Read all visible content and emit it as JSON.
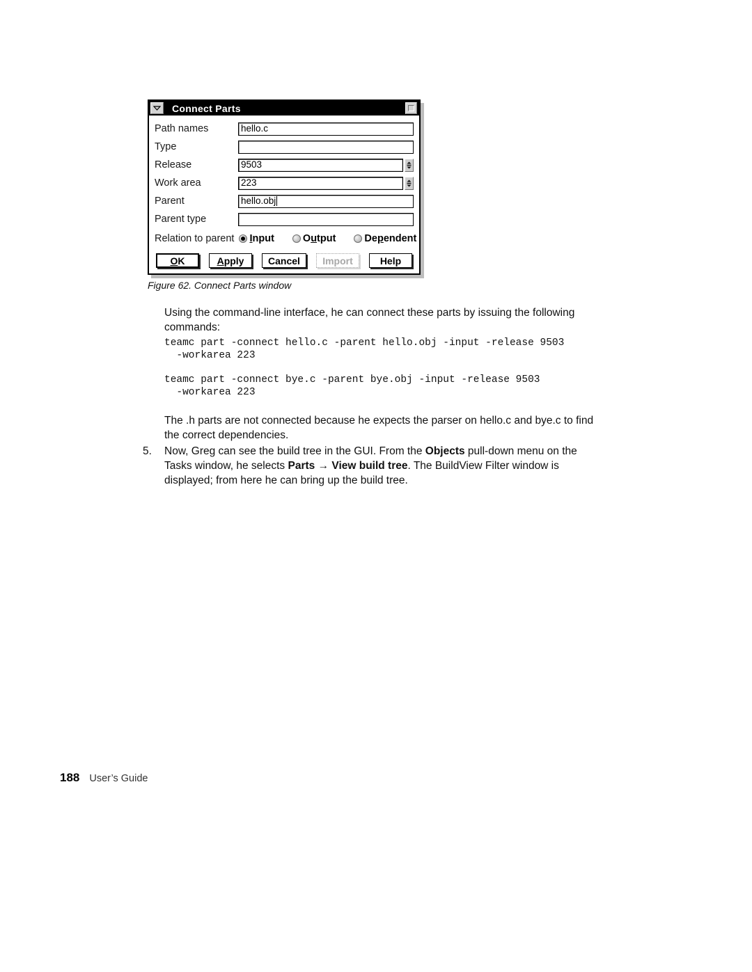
{
  "dialog": {
    "title": "Connect Parts",
    "window_menu_icon": "chevron-down-icon",
    "maximize_icon": "maximize-icon",
    "fields": [
      {
        "label": "Path names",
        "value": "hello.c",
        "spinner": false,
        "caret": false
      },
      {
        "label": "Type",
        "value": "",
        "spinner": false,
        "caret": false
      },
      {
        "label": "Release",
        "value": "9503",
        "spinner": true,
        "caret": false
      },
      {
        "label": "Work area",
        "value": "223",
        "spinner": true,
        "caret": false
      },
      {
        "label": "Parent",
        "value": "hello.obj",
        "spinner": false,
        "caret": true
      },
      {
        "label": "Parent type",
        "value": "",
        "spinner": false,
        "caret": false
      }
    ],
    "relation": {
      "label": "Relation to parent",
      "options": [
        {
          "pre": "",
          "mnemonic": "I",
          "post": "nput",
          "selected": true
        },
        {
          "pre": "O",
          "mnemonic": "u",
          "post": "tput",
          "selected": false
        },
        {
          "pre": "De",
          "mnemonic": "p",
          "post": "endent",
          "selected": false
        }
      ]
    },
    "buttons": [
      {
        "pre": "",
        "mnemonic": "O",
        "post": "K",
        "state": "default"
      },
      {
        "pre": "",
        "mnemonic": "A",
        "post": "pply",
        "state": "normal"
      },
      {
        "pre": "Cancel",
        "mnemonic": "",
        "post": "",
        "state": "normal"
      },
      {
        "pre": "Import",
        "mnemonic": "",
        "post": "",
        "state": "disabled"
      },
      {
        "pre": "Help",
        "mnemonic": "",
        "post": "",
        "state": "normal"
      }
    ]
  },
  "document": {
    "figure_caption": "Figure 62. Connect Parts window",
    "intro_paragraph": "Using the command-line interface, he can connect these parts by issuing the following commands:",
    "code_block_1": "teamc part -connect hello.c -parent hello.obj -input -release 9503\n  -workarea 223",
    "code_block_2": "teamc part -connect bye.c -parent bye.obj -input -release 9503\n  -workarea 223",
    "h_paragraph": "The .h parts are not connected because he expects the parser on hello.c and bye.c to find the correct dependencies.",
    "list_item": {
      "number": "5.",
      "part1": "Now, Greg can see the build tree in the GUI. From the ",
      "bold1": "Objects",
      "part2": " pull-down menu on the Tasks window, he selects ",
      "bold2": "Parts",
      "arrow": "→",
      "bold3": "View build tree",
      "part3": ". The BuildView Filter window is displayed; from here he can bring up the build tree."
    }
  },
  "footer": {
    "page_number": "188",
    "book_title": "User’s Guide"
  }
}
